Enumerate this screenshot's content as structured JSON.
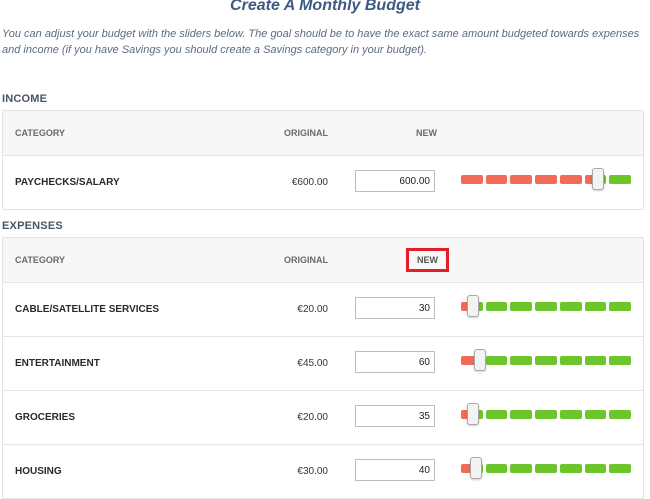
{
  "page": {
    "title": "Create A Monthly Budget",
    "intro": "You can adjust your budget with the sliders below. The goal should be to have the exact same amount budgeted towards expenses and income (if you have Savings you should create a Savings category in your budget)."
  },
  "income": {
    "label": "INCOME",
    "headers": {
      "category": "CATEGORY",
      "original": "ORIGINAL",
      "new": "NEW"
    },
    "rows": [
      {
        "category": "PAYCHECKS/SALARY",
        "original": "€600.00",
        "new": "600.00",
        "slider_fraction": 0.83
      }
    ]
  },
  "expenses": {
    "label": "EXPENSES",
    "headers": {
      "category": "CATEGORY",
      "original": "ORIGINAL",
      "new": "NEW"
    },
    "rows": [
      {
        "category": "CABLE/SATELLITE SERVICES",
        "original": "€20.00",
        "new": "30",
        "slider_fraction": 0.04
      },
      {
        "category": "ENTERTAINMENT",
        "original": "€45.00",
        "new": "60",
        "slider_fraction": 0.08
      },
      {
        "category": "GROCERIES",
        "original": "€20.00",
        "new": "35",
        "slider_fraction": 0.04
      },
      {
        "category": "HOUSING",
        "original": "€30.00",
        "new": "40",
        "slider_fraction": 0.06
      }
    ]
  },
  "colors": {
    "slider_low": "#f26b56",
    "slider_high": "#6cc52b",
    "highlight": "#e41e26",
    "title": "#3f5a82"
  }
}
